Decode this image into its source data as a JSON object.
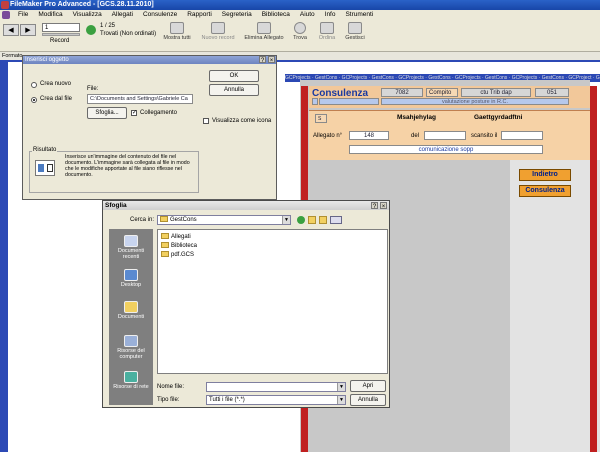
{
  "window": {
    "title": "FileMaker Pro Advanced - [GCS.28.11.2010]"
  },
  "menu": [
    "File",
    "Modifica",
    "Visualizza",
    "Allegati",
    "Consulenze",
    "Rapporti",
    "Segreteria",
    "Biblioteca",
    "Aiuto",
    "Info",
    "Strumenti"
  ],
  "toolbar": {
    "record_value": "1",
    "record_label": "Record",
    "record_total": "1 / 25",
    "found_label": "Trovati (Non ordinati)",
    "buttons": [
      "Mostra tutti",
      "Nuovo record",
      "Elimina Allegato",
      "Trova",
      "Ordina",
      "Gestisci"
    ]
  },
  "layout_bar": {
    "label": "Formato"
  },
  "path_tabs": "GCProjects · GestCons · GCProjects · GestCons · GCProjects · GestCons · GCProjects · GestCons · GCProjects · GestCons · GCProject · GestCon",
  "record": {
    "heading": "Consulenza",
    "number": "7082",
    "compito_label": "Compito",
    "compito_value": "ctu Trib dap",
    "code": "051",
    "sub_status": "valutazione posture in R.C.",
    "party1": "Msahjehylag",
    "party2": "Gaettgyrdadftni",
    "allegato_label": "Allegato n°",
    "allegato_value": "148",
    "del_label": "del",
    "scansito_label": "scansito il",
    "description": "comunicazione sopp",
    "tag_code": "S"
  },
  "nav_buttons": {
    "back": "Indietro",
    "consulenza": "Consulenza"
  },
  "insert_dialog": {
    "title": "Inserisci oggetto",
    "radio_new": "Crea nuovo",
    "radio_file": "Crea dal file",
    "file_label": "File:",
    "file_value": "C:\\Documents and Settings\\Gabriele Ca",
    "browse_button": "Sfoglia...",
    "link_checkbox": "Collegamento",
    "icon_checkbox": "Visualizza come icona",
    "ok_button": "OK",
    "cancel_button": "Annulla",
    "result_label": "Risultato",
    "result_text": "Inserisce un'immagine del contenuto del file nel documento. L'immagine sarà collegata al file in modo che le modifiche apportate al file siano riflesse nel documento."
  },
  "browse_dialog": {
    "title": "Sfoglia",
    "lookin_label": "Cerca in:",
    "lookin_value": "GestCons",
    "places": [
      "Documenti recenti",
      "Desktop",
      "Documenti",
      "Risorse del computer",
      "Risorse di rete"
    ],
    "files": [
      "Allegati",
      "Biblioteca",
      "pdf.GCS"
    ],
    "filename_label": "Nome file:",
    "filename_value": "",
    "filetype_label": "Tipo file:",
    "filetype_value": "Tutti i file (*.*)",
    "open_button": "Apri",
    "cancel_button": "Annulla"
  },
  "colors": {
    "accent_blue": "#2c49b5",
    "orange": "#f2c89a",
    "nav_orange": "#f0a030",
    "red": "#c02020"
  }
}
